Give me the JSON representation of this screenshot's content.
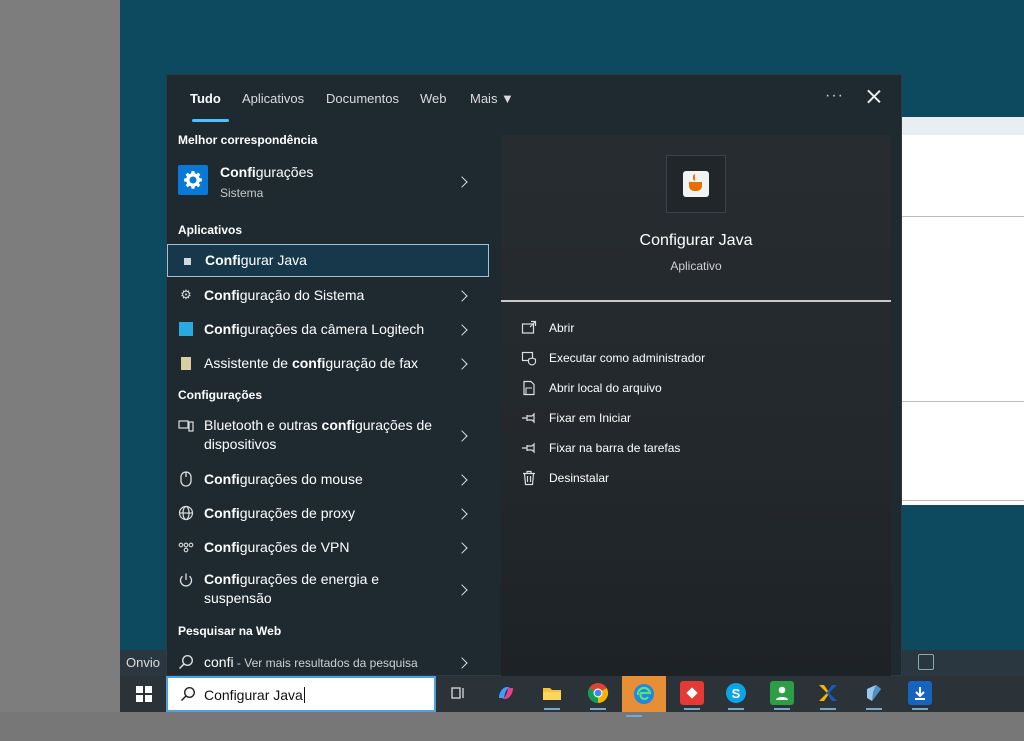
{
  "tabs": [
    {
      "label": "Tudo",
      "active": true
    },
    {
      "label": "Aplicativos"
    },
    {
      "label": "Documentos"
    },
    {
      "label": "Web"
    },
    {
      "label": "Mais ▼"
    }
  ],
  "more_options": "···",
  "sections": {
    "best_match": "Melhor correspondência",
    "apps": "Aplicativos",
    "settings": "Configurações",
    "web": "Pesquisar na Web"
  },
  "best_match": {
    "bold": "Confi",
    "rest": "gurações",
    "subtitle": "Sistema"
  },
  "apps": [
    {
      "pre": "",
      "bold": "Confi",
      "post": "gurar Java"
    },
    {
      "pre": "",
      "bold": "Confi",
      "post": "guração do Sistema"
    },
    {
      "pre": "",
      "bold": "Confi",
      "post": "gurações da câmera Logitech"
    },
    {
      "pre": "Assistente de ",
      "bold": "confi",
      "post": "guração de fax"
    }
  ],
  "settings": [
    {
      "line1_pre": "Bluetooth e outras ",
      "line1_bold": "confi",
      "line1_post": "gurações de",
      "line2": "dispositivos"
    },
    {
      "pre": "",
      "bold": "Confi",
      "post": "gurações do mouse"
    },
    {
      "pre": "",
      "bold": "Confi",
      "post": "gurações de proxy"
    },
    {
      "pre": "",
      "bold": "Confi",
      "post": "gurações de VPN"
    },
    {
      "line1_pre": "",
      "line1_bold": "Confi",
      "line1_post": "gurações de energia e",
      "line2": "suspensão"
    }
  ],
  "web_search": {
    "query": "confi",
    "suffix": " - Ver mais resultados da pesquisa"
  },
  "preview": {
    "title": "Configurar Java",
    "type": "Aplicativo",
    "actions": [
      {
        "label": "Abrir",
        "icon": "open-icon"
      },
      {
        "label": "Executar como administrador",
        "icon": "shield-icon"
      },
      {
        "label": "Abrir local do arquivo",
        "icon": "file-location-icon"
      },
      {
        "label": "Fixar em Iniciar",
        "icon": "pin-icon"
      },
      {
        "label": "Fixar na barra de tarefas",
        "icon": "pin-icon"
      },
      {
        "label": "Desinstalar",
        "icon": "trash-icon"
      }
    ]
  },
  "taskbar": {
    "search_value": "Configurar Java",
    "background_text": "Onvio"
  }
}
